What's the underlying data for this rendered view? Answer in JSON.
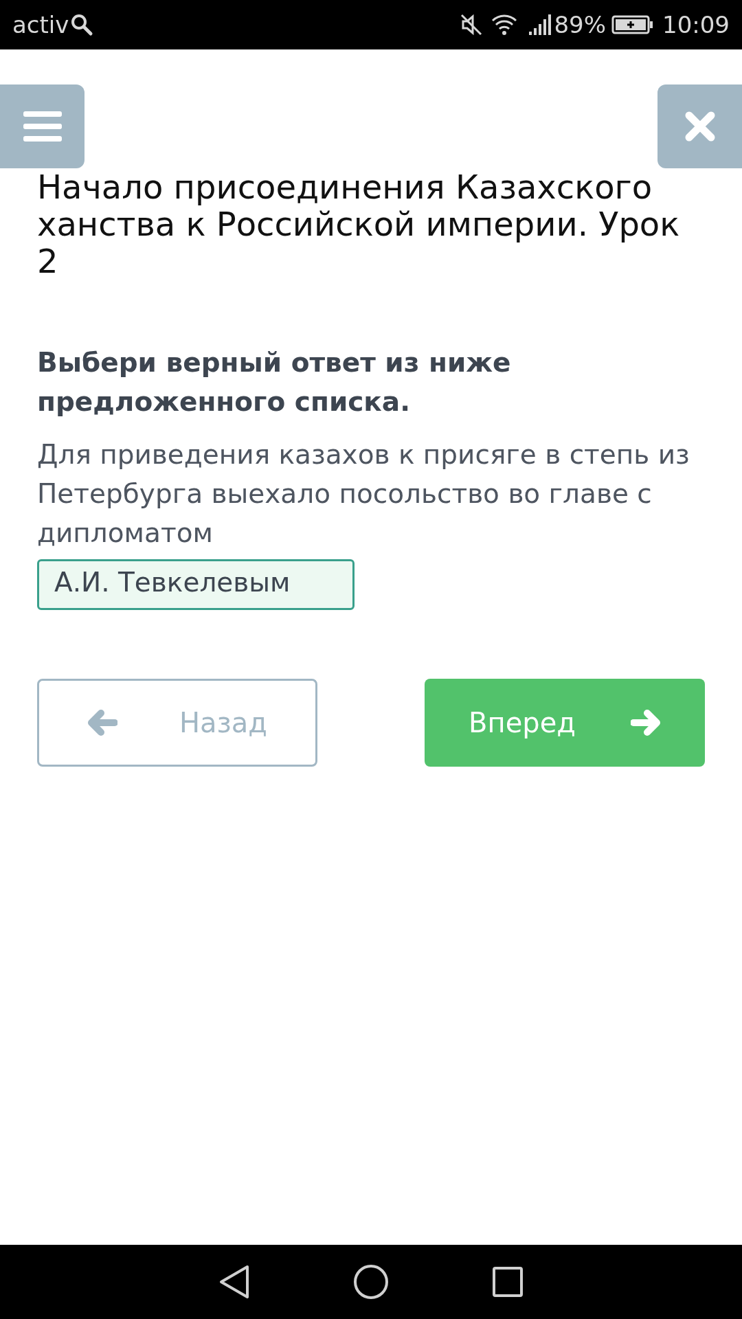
{
  "status_bar": {
    "app_label": "activ",
    "battery_percent": "89%",
    "time": "10:09"
  },
  "lesson_title": "Начало присоединения Казахского ханства к Российской империи. Урок 2",
  "instruction": "Выбери верный ответ из ниже предложенного списка.",
  "question": {
    "text": "Для приведения казахов к присяге в степь из Петербурга выехало посольство во главе с дипломатом",
    "answer": "А.И. Тевкелевым"
  },
  "buttons": [
    {
      "label": "Назад",
      "kind": "back"
    },
    {
      "label": "Вперед",
      "kind": "next"
    }
  ]
}
